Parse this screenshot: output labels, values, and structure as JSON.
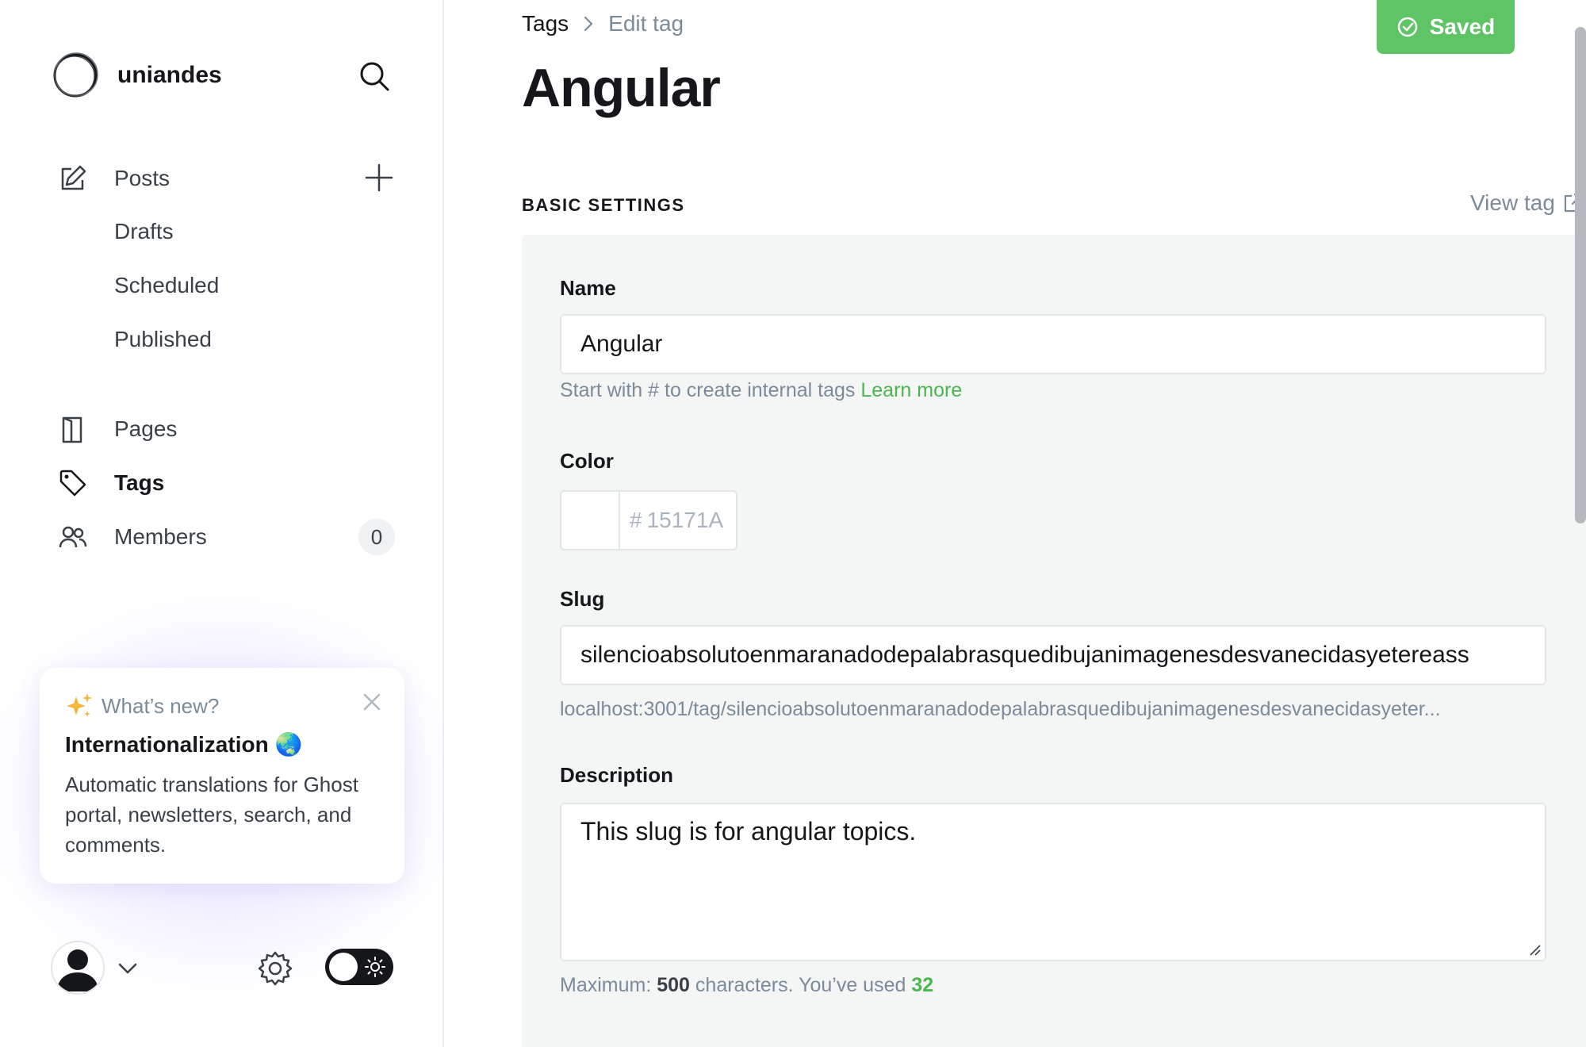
{
  "sidebar": {
    "site_name": "uniandes",
    "nav": {
      "posts": "Posts",
      "drafts": "Drafts",
      "scheduled": "Scheduled",
      "published": "Published",
      "pages": "Pages",
      "tags": "Tags",
      "members": "Members",
      "members_count": "0"
    },
    "whats_new": {
      "kicker": "What’s new?",
      "title": "Internationalization 🌏",
      "body": "Automatic translations for Ghost portal, newsletters, search, and comments."
    }
  },
  "header": {
    "breadcrumb_parent": "Tags",
    "breadcrumb_current": "Edit tag",
    "title": "Angular",
    "saved_label": "Saved",
    "accent_color": "#5ec466"
  },
  "settings": {
    "section_title": "BASIC SETTINGS",
    "view_tag": "View tag",
    "name_label": "Name",
    "name_value": "Angular",
    "name_hint": "Start with # to create internal tags",
    "name_hint_link": "Learn more",
    "color_label": "Color",
    "color_prefix": "#",
    "color_value": "15171A",
    "slug_label": "Slug",
    "slug_value": "silencioabsolutoenmaranadodepalabrasquedibujanimagenesdesvanecidasyetereass",
    "slug_url": "localhost:3001/tag/silencioabsolutoenmaranadodepalabrasquedibujanimagenesdesvanecidasyeter...",
    "description_label": "Description",
    "description_value": "This slug is for angular topics.",
    "desc_hint_prefix": "Maximum:",
    "desc_hint_max": "500",
    "desc_hint_mid": "characters. You’ve used",
    "desc_hint_used": "32"
  }
}
